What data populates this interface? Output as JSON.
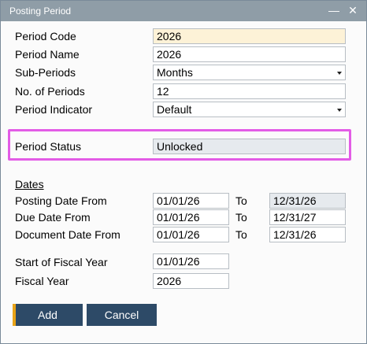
{
  "window": {
    "title": "Posting Period",
    "minimize_icon": "minimize-icon",
    "close_icon": "close-icon"
  },
  "fields": {
    "period_code": {
      "label": "Period Code",
      "value": "2026"
    },
    "period_name": {
      "label": "Period Name",
      "value": "2026"
    },
    "sub_periods": {
      "label": "Sub-Periods",
      "value": "Months"
    },
    "no_of_periods": {
      "label": "No. of Periods",
      "value": "12"
    },
    "period_indicator": {
      "label": "Period Indicator",
      "value": "Default"
    },
    "period_status": {
      "label": "Period Status",
      "value": "Unlocked"
    }
  },
  "dates": {
    "section_label": "Dates",
    "to_label": "To",
    "posting": {
      "label": "Posting Date From",
      "from": "01/01/26",
      "to": "12/31/26"
    },
    "due": {
      "label": "Due Date From",
      "from": "01/01/26",
      "to": "12/31/27"
    },
    "document": {
      "label": "Document Date From",
      "from": "01/01/26",
      "to": "12/31/26"
    }
  },
  "fiscal": {
    "start": {
      "label": "Start of Fiscal Year",
      "value": "01/01/26"
    },
    "year": {
      "label": "Fiscal Year",
      "value": "2026"
    }
  },
  "buttons": {
    "add": "Add",
    "cancel": "Cancel"
  },
  "colors": {
    "titlebar": "#8f9da7",
    "button": "#2d4a67",
    "accent": "#e8a317",
    "highlight": "#e35ce6",
    "key_field": "#fdf2d7",
    "readonly_field": "#e6eaee"
  }
}
